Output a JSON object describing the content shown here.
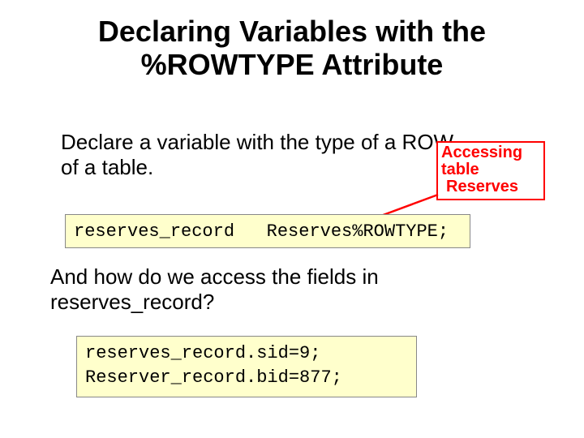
{
  "title_line1": "Declaring Variables with the",
  "title_line2": "%ROWTYPE Attribute",
  "intro_text": "Declare a variable with the type of a ROW of a table.",
  "annotation_line1": "Accessing",
  "annotation_line2": "table",
  "annotation_line3": "Reserves",
  "code1_text": "reserves_record   Reserves%ROWTYPE;",
  "question_text": "And how do we access the fields in reserves_record?",
  "code2_line1": "reserves_record.sid=9;",
  "code2_line2": "Reserver_record.bid=877;"
}
